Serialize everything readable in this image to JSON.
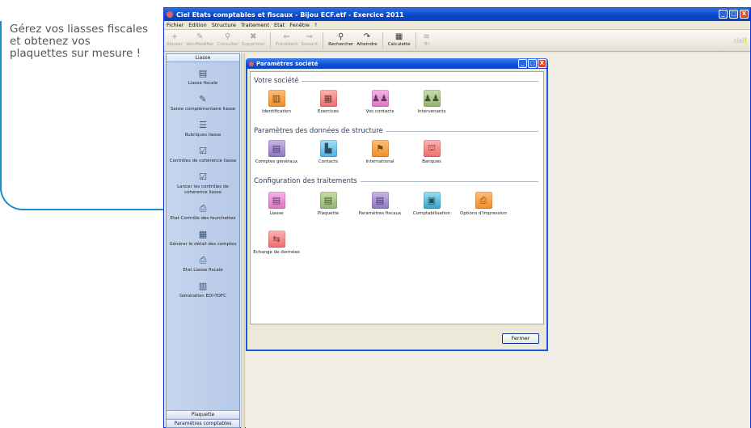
{
  "promo": {
    "text": "Gérez vos liasses fiscales et obtenez vos plaquettes sur mesure !"
  },
  "app": {
    "title": "Ciel Etats comptables et fiscaux - Bijou ECF.etf - Exercice 2011",
    "title_buttons": [
      "_",
      "□",
      "X"
    ],
    "menu": [
      "Fichier",
      "Edition",
      "Structure",
      "Traitement",
      "Etat",
      "Fenêtre",
      "?"
    ],
    "toolbar": [
      {
        "label": "Ajouter",
        "icon": "plus-icon",
        "glyph": "+",
        "enabled": false
      },
      {
        "label": "Voir/Modifier",
        "icon": "pencil-icon",
        "glyph": "✎",
        "enabled": false
      },
      {
        "label": "Consulter",
        "icon": "magnifier-icon",
        "glyph": "⚲",
        "enabled": false
      },
      {
        "label": "Supprimer",
        "icon": "delete-icon",
        "glyph": "✖",
        "enabled": false
      },
      {
        "label": "Précédent",
        "icon": "arrow-left-icon",
        "glyph": "⇐",
        "enabled": false
      },
      {
        "label": "Suivant",
        "icon": "arrow-right-icon",
        "glyph": "⇒",
        "enabled": false
      },
      {
        "label": "Rechercher",
        "icon": "search-icon",
        "glyph": "⚲",
        "enabled": true
      },
      {
        "label": "Atteindre",
        "icon": "goto-icon",
        "glyph": "↷",
        "enabled": true
      },
      {
        "label": "Calculette",
        "icon": "calculator-icon",
        "glyph": "▦",
        "enabled": true
      },
      {
        "label": "Tri",
        "icon": "sort-icon",
        "glyph": "≡",
        "enabled": false
      }
    ],
    "logo": {
      "text": "ciel",
      "mark": "!"
    }
  },
  "left_panel": {
    "header": "Liasse",
    "items": [
      {
        "label": "Liasse fiscale",
        "icon": "document-icon",
        "glyph": "▤"
      },
      {
        "label": "Saisie complémentaire liasse",
        "icon": "pencil-icon",
        "glyph": "✎"
      },
      {
        "label": "Rubriques liasse",
        "icon": "list-icon",
        "glyph": "☰"
      },
      {
        "label": "Contrôles de cohérence liasse",
        "icon": "checkbox-icon",
        "glyph": "☑"
      },
      {
        "label": "Lancer les contrôles de cohérence liasse",
        "icon": "checkbox-icon",
        "glyph": "☑"
      },
      {
        "label": "Etat Contrôle des fourchettes",
        "icon": "printer-icon",
        "glyph": "⎙"
      },
      {
        "label": "Générer le détail des comptes",
        "icon": "table-icon",
        "glyph": "▦"
      },
      {
        "label": "Etat Liasse fiscale",
        "icon": "printer-icon",
        "glyph": "⎙"
      },
      {
        "label": "Génération EDI-TDFC",
        "icon": "edi-file-icon",
        "glyph": "▥"
      }
    ],
    "footers": [
      "Plaquette",
      "Paramètres comptables"
    ]
  },
  "dialog": {
    "title": "Paramètres société",
    "title_buttons": [
      "_",
      "□",
      "X"
    ],
    "sections": [
      {
        "title": "Votre société",
        "tiles": [
          {
            "label": "Identification",
            "icon": "building-icon",
            "glyph": "▥",
            "color": "orange"
          },
          {
            "label": "Exercices",
            "icon": "calendar-icon",
            "glyph": "▦",
            "color": "pink"
          },
          {
            "label": "Vos contacts",
            "icon": "contacts-icon",
            "glyph": "♟♟",
            "color": "magenta"
          },
          {
            "label": "Intervenants",
            "icon": "people-icon",
            "glyph": "♟♟",
            "color": "green"
          }
        ]
      },
      {
        "title": "Paramètres des données de structure",
        "tiles": [
          {
            "label": "Comptes généraux",
            "icon": "ledger-icon",
            "glyph": "▤",
            "color": "purple"
          },
          {
            "label": "Contacts",
            "icon": "office-building-icon",
            "glyph": "▙",
            "color": "blue"
          },
          {
            "label": "International",
            "icon": "flags-icon",
            "glyph": "⚑",
            "color": "orange"
          },
          {
            "label": "Banques",
            "icon": "bank-icon",
            "glyph": "⛫",
            "color": "pink"
          }
        ]
      },
      {
        "title": "Configuration des traitements",
        "tiles": [
          {
            "label": "Liasse",
            "icon": "document-icon",
            "glyph": "▤",
            "color": "magenta"
          },
          {
            "label": "Plaquette",
            "icon": "booklet-icon",
            "glyph": "▤",
            "color": "green"
          },
          {
            "label": "Paramètres fiscaux",
            "icon": "tax-document-icon",
            "glyph": "▤",
            "color": "purple"
          },
          {
            "label": "Comptabilisation",
            "icon": "accounting-book-icon",
            "glyph": "▣",
            "color": "teal"
          },
          {
            "label": "Options d'impression",
            "icon": "printer-icon",
            "glyph": "⎙",
            "color": "orange"
          },
          {
            "label": "Echange de données",
            "icon": "data-exchange-icon",
            "glyph": "⇆",
            "color": "pink"
          }
        ]
      }
    ],
    "close_button": "Fermer"
  }
}
